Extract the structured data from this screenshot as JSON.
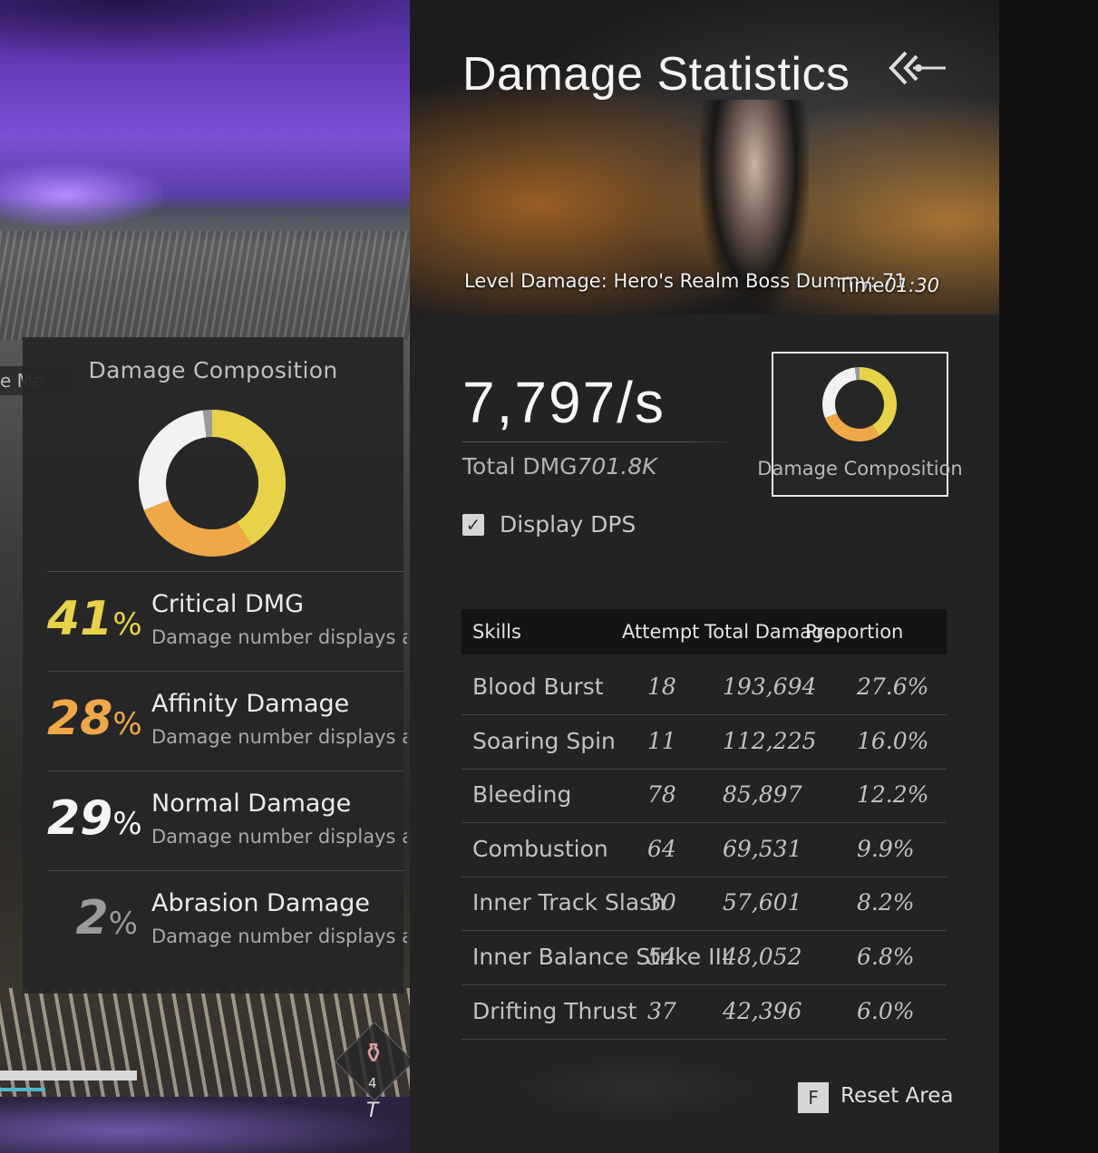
{
  "side_tab": "e Me",
  "potion": {
    "count": "4",
    "key": "T"
  },
  "composition_panel": {
    "title": "Damage Composition",
    "donut": {
      "colors": [
        "#e8d24a",
        "#eea848",
        "#f2f2f2",
        "#9a9a9a"
      ],
      "fractions": [
        0.41,
        0.28,
        0.29,
        0.02
      ]
    },
    "rows": [
      {
        "pct": "41",
        "unit": "%",
        "name": "Critical DMG",
        "desc": "Damage number displays as",
        "color": "#e8d24a"
      },
      {
        "pct": "28",
        "unit": "%",
        "name": "Affinity Damage",
        "desc": "Damage number displays as",
        "color": "#eea848"
      },
      {
        "pct": "29",
        "unit": "%",
        "name": "Normal Damage",
        "desc": "Damage number displays as",
        "color": "#f4f4f4"
      },
      {
        "pct": "2",
        "unit": "%",
        "name": "Abrasion Damage",
        "desc": "Damage number displays as",
        "color": "#9a9a9a"
      }
    ]
  },
  "main": {
    "title": "Damage Statistics",
    "back_icon": "back-arrow-icon",
    "level_label": "Level Damage: Hero's Realm Boss Dummy: 71",
    "time_label": "Time",
    "time_value": "01:30",
    "dps": "7,797/s",
    "total_label": "Total DMG",
    "total_value": "701.8K",
    "composition_button_label": "Damage Composition",
    "display_dps_label": "Display DPS",
    "display_dps_checked": true,
    "table": {
      "headers": {
        "skills": "Skills",
        "attempt": "Attempt",
        "total": "Total Damage",
        "proportion": "Proportion"
      },
      "rows": [
        {
          "skill": "Blood Burst",
          "attempt": "18",
          "damage": "193,694",
          "proportion": "27.6%"
        },
        {
          "skill": "Soaring Spin",
          "attempt": "11",
          "damage": "112,225",
          "proportion": "16.0%"
        },
        {
          "skill": "Bleeding",
          "attempt": "78",
          "damage": "85,897",
          "proportion": "12.2%"
        },
        {
          "skill": "Combustion",
          "attempt": "64",
          "damage": "69,531",
          "proportion": "9.9%"
        },
        {
          "skill": "Inner Track Slash",
          "attempt": "30",
          "damage": "57,601",
          "proportion": "8.2%"
        },
        {
          "skill": "Inner Balance Strike III",
          "attempt": "54",
          "damage": "48,052",
          "proportion": "6.8%"
        },
        {
          "skill": "Drifting Thrust",
          "attempt": "37",
          "damage": "42,396",
          "proportion": "6.0%"
        }
      ]
    },
    "reset": {
      "key": "F",
      "label": "Reset Area"
    }
  }
}
